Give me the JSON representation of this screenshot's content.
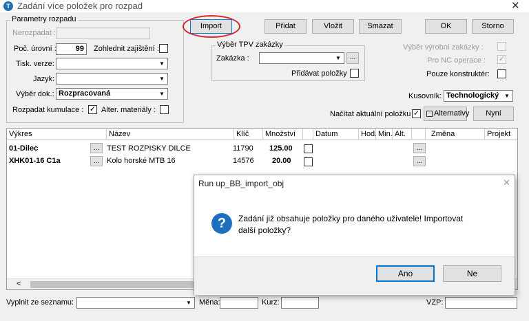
{
  "window": {
    "title": "Zadání více položek pro rozpad",
    "icon_letter": "T",
    "close_glyph": "✕"
  },
  "params": {
    "legend": "Parametry rozpadu",
    "nerozpadat_label": "Nerozpadat :",
    "poc_urovni_label": "Poč. úrovní :",
    "poc_urovni_value": "99",
    "zohlednit_label": "Zohlednit zajištění :",
    "tisk_verze_label": "Tisk. verze:",
    "jazyk_label": "Jazyk:",
    "vyber_dok_label": "Výběr dok.:",
    "vyber_dok_value": "Rozpracovaná",
    "rozpadat_kumulace_label": "Rozpadat kumulace :",
    "rozpadat_kumulace_checked": "✓",
    "alter_materialy_label": "Alter. materiály :"
  },
  "toolbar": {
    "import": "Import",
    "pridat": "Přidat",
    "vlozit": "Vložit",
    "smazat": "Smazat",
    "ok": "OK",
    "storno": "Storno"
  },
  "tpv": {
    "legend": "Výběr TPV zakázky",
    "zakazka_label": "Zakázka :",
    "browse": "...",
    "pridavat_label": "Přidávat položky"
  },
  "right": {
    "vyber_vyrobni_label": "Výběr výrobní zakázky :",
    "pro_nc_label": "Pro NC operace :",
    "pro_nc_checked": "✓",
    "pouze_konstrukter_label": "Pouze konstruktér:",
    "kusovnik_label": "Kusovník:",
    "kusovnik_value": "Technologický",
    "nacitat_label": "Načítat aktuální položku",
    "nacitat_checked": "✓",
    "alternativy": "Alternativy",
    "nyni": "Nyní"
  },
  "grid": {
    "columns": [
      "Výkres",
      "Název",
      "Klíč",
      "Množství",
      "Datum",
      "Hod.",
      "Min.",
      "Alt.",
      "Změna",
      "Projekt"
    ],
    "browse": "...",
    "rows": [
      {
        "vykres": "01-Dilec",
        "nazev": "TEST ROZPISKY DILCE",
        "klic": "11790",
        "mnozstvi": "125.00"
      },
      {
        "vykres": "XHK01-16 C1a",
        "nazev": "Kolo horské MTB 16",
        "klic": "14576",
        "mnozstvi": "20.00"
      }
    ],
    "scroll_left": "<"
  },
  "bottom": {
    "vyplnit_label": "Vyplnit ze seznamu:",
    "mena_label": "Měna:",
    "kurz_label": "Kurz:",
    "vzp_label": "VZP:"
  },
  "dialog": {
    "title": "Run up_BB_import_obj",
    "icon": "?",
    "message_line1": "Zadání již obsahuje položky pro daného uživatele! Importovat",
    "message_line2": "další položky?",
    "yes": "Ano",
    "no": "Ne",
    "close_glyph": "✕"
  },
  "colors": {
    "highlight_ellipse": "#d9262c",
    "dialog_icon": "#1f6fc0",
    "focus_button": "#0078d7"
  }
}
